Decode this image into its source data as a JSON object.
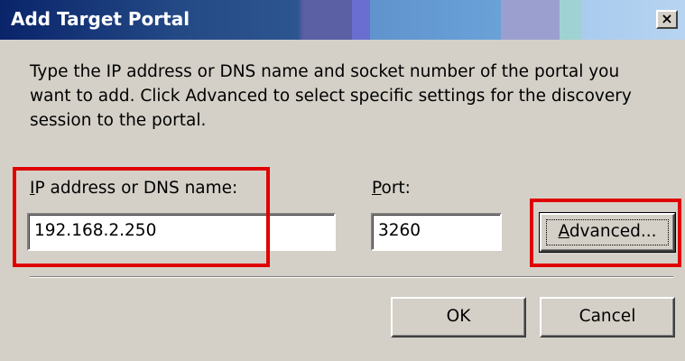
{
  "dialog": {
    "title": "Add Target Portal",
    "close_glyph": "×",
    "description_lines": [
      "Type the IP address or DNS name and socket number of the portal you",
      "want to add. Click Advanced to select specific settings for the discovery",
      "session to the portal."
    ],
    "ip_label": {
      "accesskey": "I",
      "rest": "P address or DNS name:"
    },
    "ip_value": "192.168.2.250",
    "port_label": {
      "accesskey": "P",
      "rest": "ort:"
    },
    "port_value": "3260",
    "advanced_button": {
      "accesskey": "A",
      "rest": "dvanced..."
    },
    "ok_label": "OK",
    "cancel_label": "Cancel"
  },
  "colors": {
    "highlight": "#e00000",
    "dialog_face": "#d4d0c8",
    "title_start": "#0a246a"
  },
  "icons": [
    "close-icon"
  ]
}
